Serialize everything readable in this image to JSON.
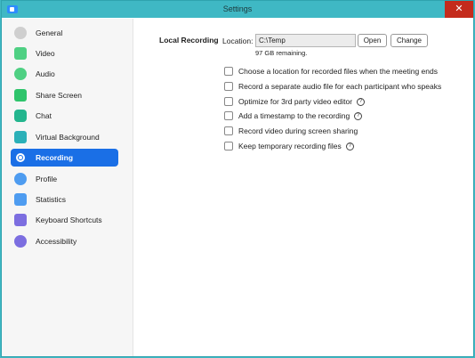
{
  "window": {
    "title": "Settings",
    "close_glyph": "✕"
  },
  "sidebar": {
    "items": [
      {
        "label": "General",
        "icon": "gear-icon",
        "color": "#cfcfcf"
      },
      {
        "label": "Video",
        "icon": "video-icon",
        "color": "#4fd083"
      },
      {
        "label": "Audio",
        "icon": "headphones-icon",
        "color": "#4fd083"
      },
      {
        "label": "Share Screen",
        "icon": "share-screen-icon",
        "color": "#2ec46b"
      },
      {
        "label": "Chat",
        "icon": "chat-icon",
        "color": "#23b58e"
      },
      {
        "label": "Virtual Background",
        "icon": "virtual-background-icon",
        "color": "#2bb0b8"
      },
      {
        "label": "Recording",
        "icon": "recording-icon",
        "color": "#ffffff",
        "active": true
      },
      {
        "label": "Profile",
        "icon": "profile-icon",
        "color": "#4e9cf0"
      },
      {
        "label": "Statistics",
        "icon": "statistics-icon",
        "color": "#4e9cf0"
      },
      {
        "label": "Keyboard Shortcuts",
        "icon": "keyboard-icon",
        "color": "#7c6ee0"
      },
      {
        "label": "Accessibility",
        "icon": "accessibility-icon",
        "color": "#7c6ee0"
      }
    ]
  },
  "recording": {
    "section_title": "Local Recording",
    "location_label": "Location:",
    "location_value": "C:\\Temp",
    "open_label": "Open",
    "change_label": "Change",
    "remaining": "97 GB remaining.",
    "help_glyph": "?",
    "options": [
      {
        "label": "Choose a location for recorded files when the meeting ends",
        "checked": false,
        "help": false
      },
      {
        "label": "Record a separate audio file for each participant who speaks",
        "checked": false,
        "help": false
      },
      {
        "label": "Optimize for 3rd party video editor",
        "checked": false,
        "help": true
      },
      {
        "label": "Add a timestamp to the recording",
        "checked": false,
        "help": true
      },
      {
        "label": "Record video during screen sharing",
        "checked": false,
        "help": false
      },
      {
        "label": "Keep temporary recording files",
        "checked": false,
        "help": true
      }
    ]
  },
  "colors": {
    "accent": "#1a6fe6",
    "titlebar": "#3fb8c4",
    "close": "#c42b1c"
  }
}
